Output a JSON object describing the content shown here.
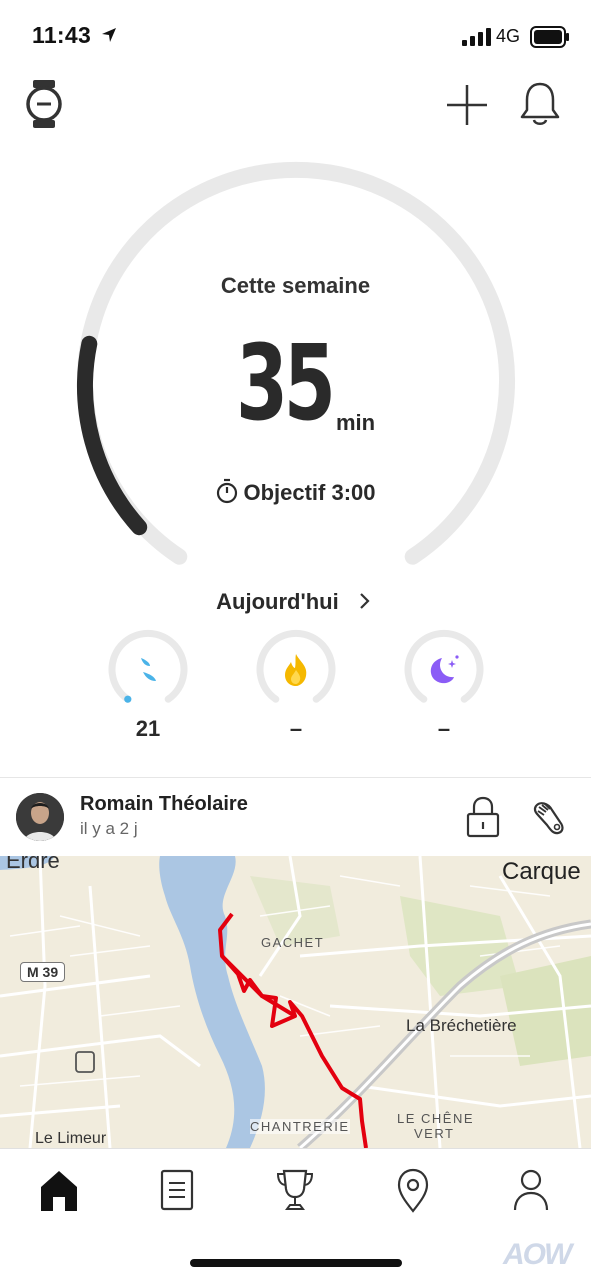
{
  "status_bar": {
    "time": "11:43",
    "network": "4G"
  },
  "summary": {
    "period_label": "Cette semaine",
    "value": "35",
    "unit": "min",
    "goal_label": "Objectif 3:00",
    "progress_fraction": 0.194
  },
  "today": {
    "label": "Aujourd'hui",
    "metrics": [
      {
        "icon": "steps-icon",
        "value": "21",
        "color": "#4ab3e8"
      },
      {
        "icon": "flame-icon",
        "value": "–",
        "color": "#f5b800"
      },
      {
        "icon": "moon-icon",
        "value": "–",
        "color": "#8b5cf6"
      }
    ]
  },
  "feed": {
    "author": "Romain Théolaire",
    "time_ago": "il y a 2 j",
    "map_labels": {
      "top_left": "Erdre",
      "top_right": "Carque",
      "road": "M 39",
      "gachet": "GACHET",
      "brechetiere": "La Bréchetière",
      "chene_vert_1": "LE CHÊNE",
      "chene_vert_2": "VERT",
      "chantrerie": "CHANTRERIE",
      "limeur": "Le Limeur"
    }
  },
  "tabbar": [
    "home-icon",
    "diary-icon",
    "trophy-icon",
    "map-pin-icon",
    "profile-icon"
  ],
  "watermark": "AOW",
  "colors": {
    "ring_bg": "#e9e9e9",
    "ring_fg": "#2b2b2b",
    "route": "#e3000f"
  }
}
